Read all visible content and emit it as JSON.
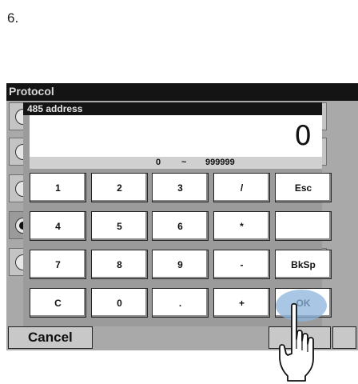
{
  "step": "6.",
  "window": {
    "title": "Protocol"
  },
  "protocol_rows": [
    {
      "selected": false
    },
    {
      "selected": false
    },
    {
      "selected": false
    },
    {
      "selected": true
    },
    {
      "selected": false
    }
  ],
  "bottom": {
    "cancel_label": "Cancel"
  },
  "keypad": {
    "title": "485 address",
    "value": "0",
    "range_min": "0",
    "range_sep": "~",
    "range_max": "999999",
    "keys": [
      [
        "1",
        "2",
        "3",
        "/",
        "Esc"
      ],
      [
        "4",
        "5",
        "6",
        "*",
        ""
      ],
      [
        "7",
        "8",
        "9",
        "-",
        "BkSp"
      ],
      [
        "C",
        "0",
        ".",
        "+",
        "OK"
      ]
    ]
  },
  "colors": {
    "titlebar": "#141414",
    "panel": "#a9a9a9",
    "highlight": "#8cb4dc"
  },
  "icons": {
    "pointer": "hand-pointer-icon"
  }
}
